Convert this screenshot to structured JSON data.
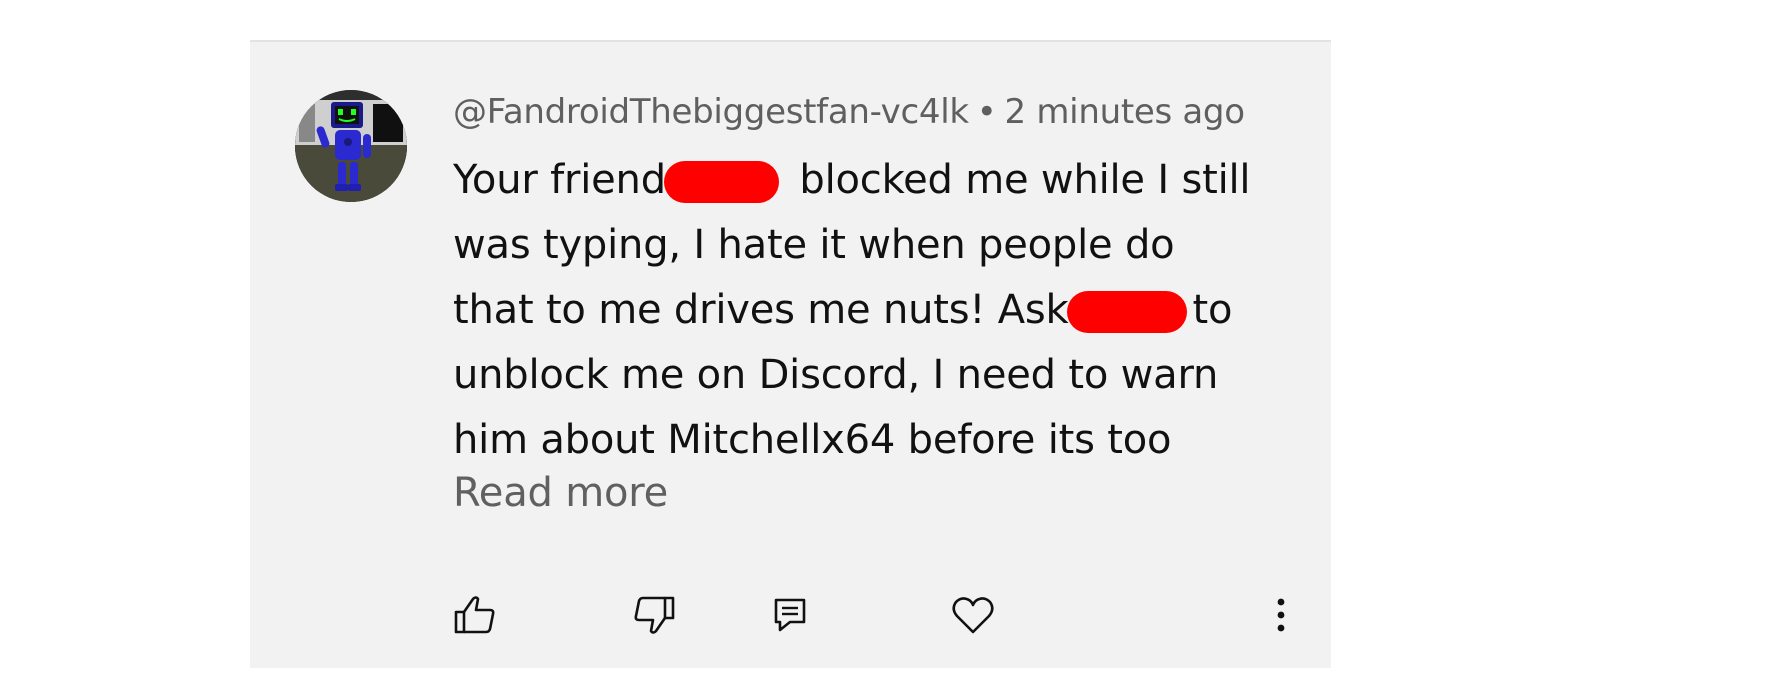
{
  "comment": {
    "author": "@FandroidThebiggestfan-vc4lk",
    "separator": "•",
    "timestamp": "2 minutes ago",
    "lines": [
      {
        "before": "Your friend",
        "after": " blocked me while I still"
      },
      {
        "text": "was typing, I hate it when people do"
      },
      {
        "before": "that to me drives me nuts! Ask",
        "after": "to"
      },
      {
        "text": "unblock me on Discord, I need to warn"
      },
      {
        "text": "him about Mitchellx64 before its too"
      }
    ],
    "read_more": "Read more"
  },
  "icons": {
    "avatar": "robot-avatar",
    "like": "thumbs-up-icon",
    "dislike": "thumbs-down-icon",
    "reply": "comment-icon",
    "heart": "heart-icon",
    "more": "more-vertical-icon"
  },
  "colors": {
    "card_background": "#f2f2f2",
    "redaction": "#ff0000",
    "text_primary": "#111111",
    "text_secondary": "#5f5f5f"
  }
}
